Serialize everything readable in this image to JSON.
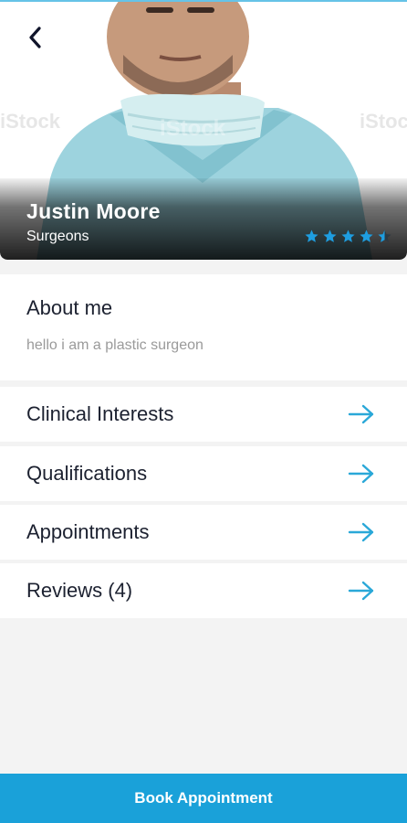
{
  "doctor": {
    "name": "Justin Moore",
    "specialty": "Surgeons",
    "rating": 4.5,
    "rating_max": 5,
    "photo_watermark": "iStock"
  },
  "about": {
    "title": "About me",
    "text": "hello i am a plastic surgeon"
  },
  "menu": [
    {
      "label": "Clinical Interests",
      "icon": "arrow-right-icon"
    },
    {
      "label": "Qualifications",
      "icon": "arrow-right-icon"
    },
    {
      "label": "Appointments",
      "icon": "arrow-right-icon"
    },
    {
      "label": "Reviews (4)",
      "icon": "arrow-right-icon"
    }
  ],
  "book_button": "Book Appointment",
  "colors": {
    "accent": "#1aa1d9",
    "star": "#1e9ee0",
    "arrow": "#2aa8d8",
    "heading": "#1c2130",
    "muted": "#9a9a9a",
    "background": "#f3f3f3"
  },
  "icons": {
    "back": "chevron-left-icon",
    "star": "star-icon"
  }
}
